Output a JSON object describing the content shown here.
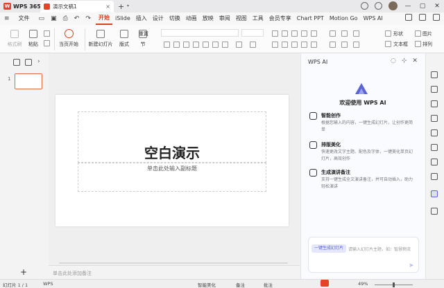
{
  "titlebar": {
    "app_name": "WPS 365",
    "tab_title": "演示文稿1",
    "new_tab": "+",
    "close": "×"
  },
  "menubar": {
    "file": "文件",
    "items": [
      "开始",
      "iSlide",
      "插入",
      "设计",
      "切换",
      "动画",
      "放映",
      "审阅",
      "视图",
      "工具",
      "会员专享",
      "Chart PPT",
      "Motion Go",
      "WPS AI"
    ],
    "active_index": 0
  },
  "ribbon": {
    "format_painter": "格式刷",
    "paste": "粘贴",
    "play_current": "当页开始",
    "new_slide": "新建幻灯片",
    "layout": "版式",
    "section": "节",
    "reset": "重置",
    "shape": "形状",
    "textbox": "文本框",
    "picture": "图片",
    "arrange": "排列"
  },
  "slide": {
    "number": "1",
    "title": "空白演示",
    "subtitle": "单击此处输入副标题",
    "notes_placeholder": "单击此处添加备注"
  },
  "ai_panel": {
    "header": "WPS AI",
    "welcome": "欢迎使用 WPS AI",
    "features": [
      {
        "title": "智能创作",
        "desc": "根据您输入的内容，一键生成幻灯片，让创作更简单"
      },
      {
        "title": "排版美化",
        "desc": "快速更改文字主题、配色及字体，一键美化单页幻灯片，高效创作"
      },
      {
        "title": "生成演讲备注",
        "desc": "支持一键生成全文演讲备注，并可自动插入，助力轻松演讲"
      }
    ],
    "chip": "一键生成幻灯片",
    "input_placeholder": "请输入幻灯片主题，如：智慧物流",
    "send": "➤"
  },
  "statusbar": {
    "slide_count": "幻灯片 1 / 1",
    "theme": "WPS",
    "beautify": "智能美化",
    "notes": "备注",
    "comments": "批注",
    "zoom": "49%"
  },
  "colors": {
    "accent": "#d6401f",
    "ai": "#5b63d6"
  }
}
